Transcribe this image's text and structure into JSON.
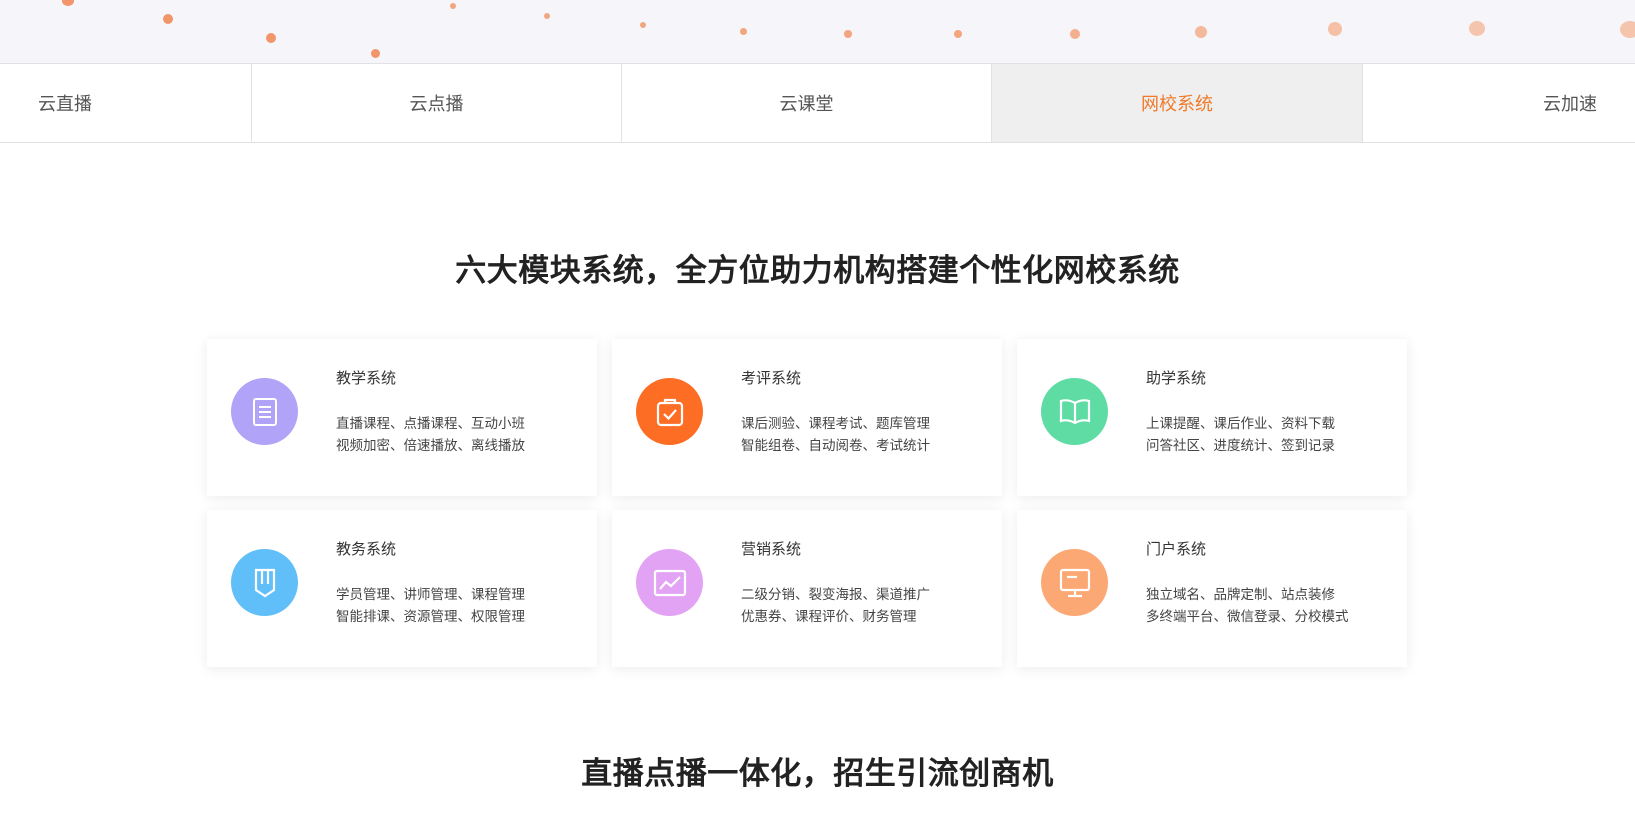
{
  "tabs": [
    {
      "label": "云直播",
      "active": false
    },
    {
      "label": "云点播",
      "active": false
    },
    {
      "label": "云课堂",
      "active": false
    },
    {
      "label": "网校系统",
      "active": true
    },
    {
      "label": "云加速",
      "active": false
    }
  ],
  "colors": {
    "accent": "#f07a29",
    "dot": "#f0a070"
  },
  "section1": {
    "title": "六大模块系统，全方位助力机构搭建个性化网校系统"
  },
  "modules": [
    {
      "name": "教学系统",
      "line1": "直播课程、点播课程、互动小班",
      "line2": "视频加密、倍速播放、离线播放",
      "icon": "document-icon",
      "color": "#b1a3f7"
    },
    {
      "name": "考评系统",
      "line1": "课后测验、课程考试、题库管理",
      "line2": "智能组卷、自动阅卷、考试统计",
      "icon": "clipboard-check-icon",
      "color": "#fd6d24"
    },
    {
      "name": "助学系统",
      "line1": "上课提醒、课后作业、资料下载",
      "line2": "问答社区、进度统计、签到记录",
      "icon": "open-book-icon",
      "color": "#5fdca4"
    },
    {
      "name": "教务系统",
      "line1": "学员管理、讲师管理、课程管理",
      "line2": "智能排课、资源管理、权限管理",
      "icon": "bookmark-badge-icon",
      "color": "#60bff8"
    },
    {
      "name": "营销系统",
      "line1": "二级分销、裂变海报、渠道推广",
      "line2": "优惠券、课程评价、财务管理",
      "icon": "trend-chart-icon",
      "color": "#e3a3f5"
    },
    {
      "name": "门户系统",
      "line1": "独立域名、品牌定制、站点装修",
      "line2": "多终端平台、微信登录、分校模式",
      "icon": "monitor-icon",
      "color": "#fca874"
    }
  ],
  "section2": {
    "title": "直播点播一体化，招生引流创商机"
  }
}
